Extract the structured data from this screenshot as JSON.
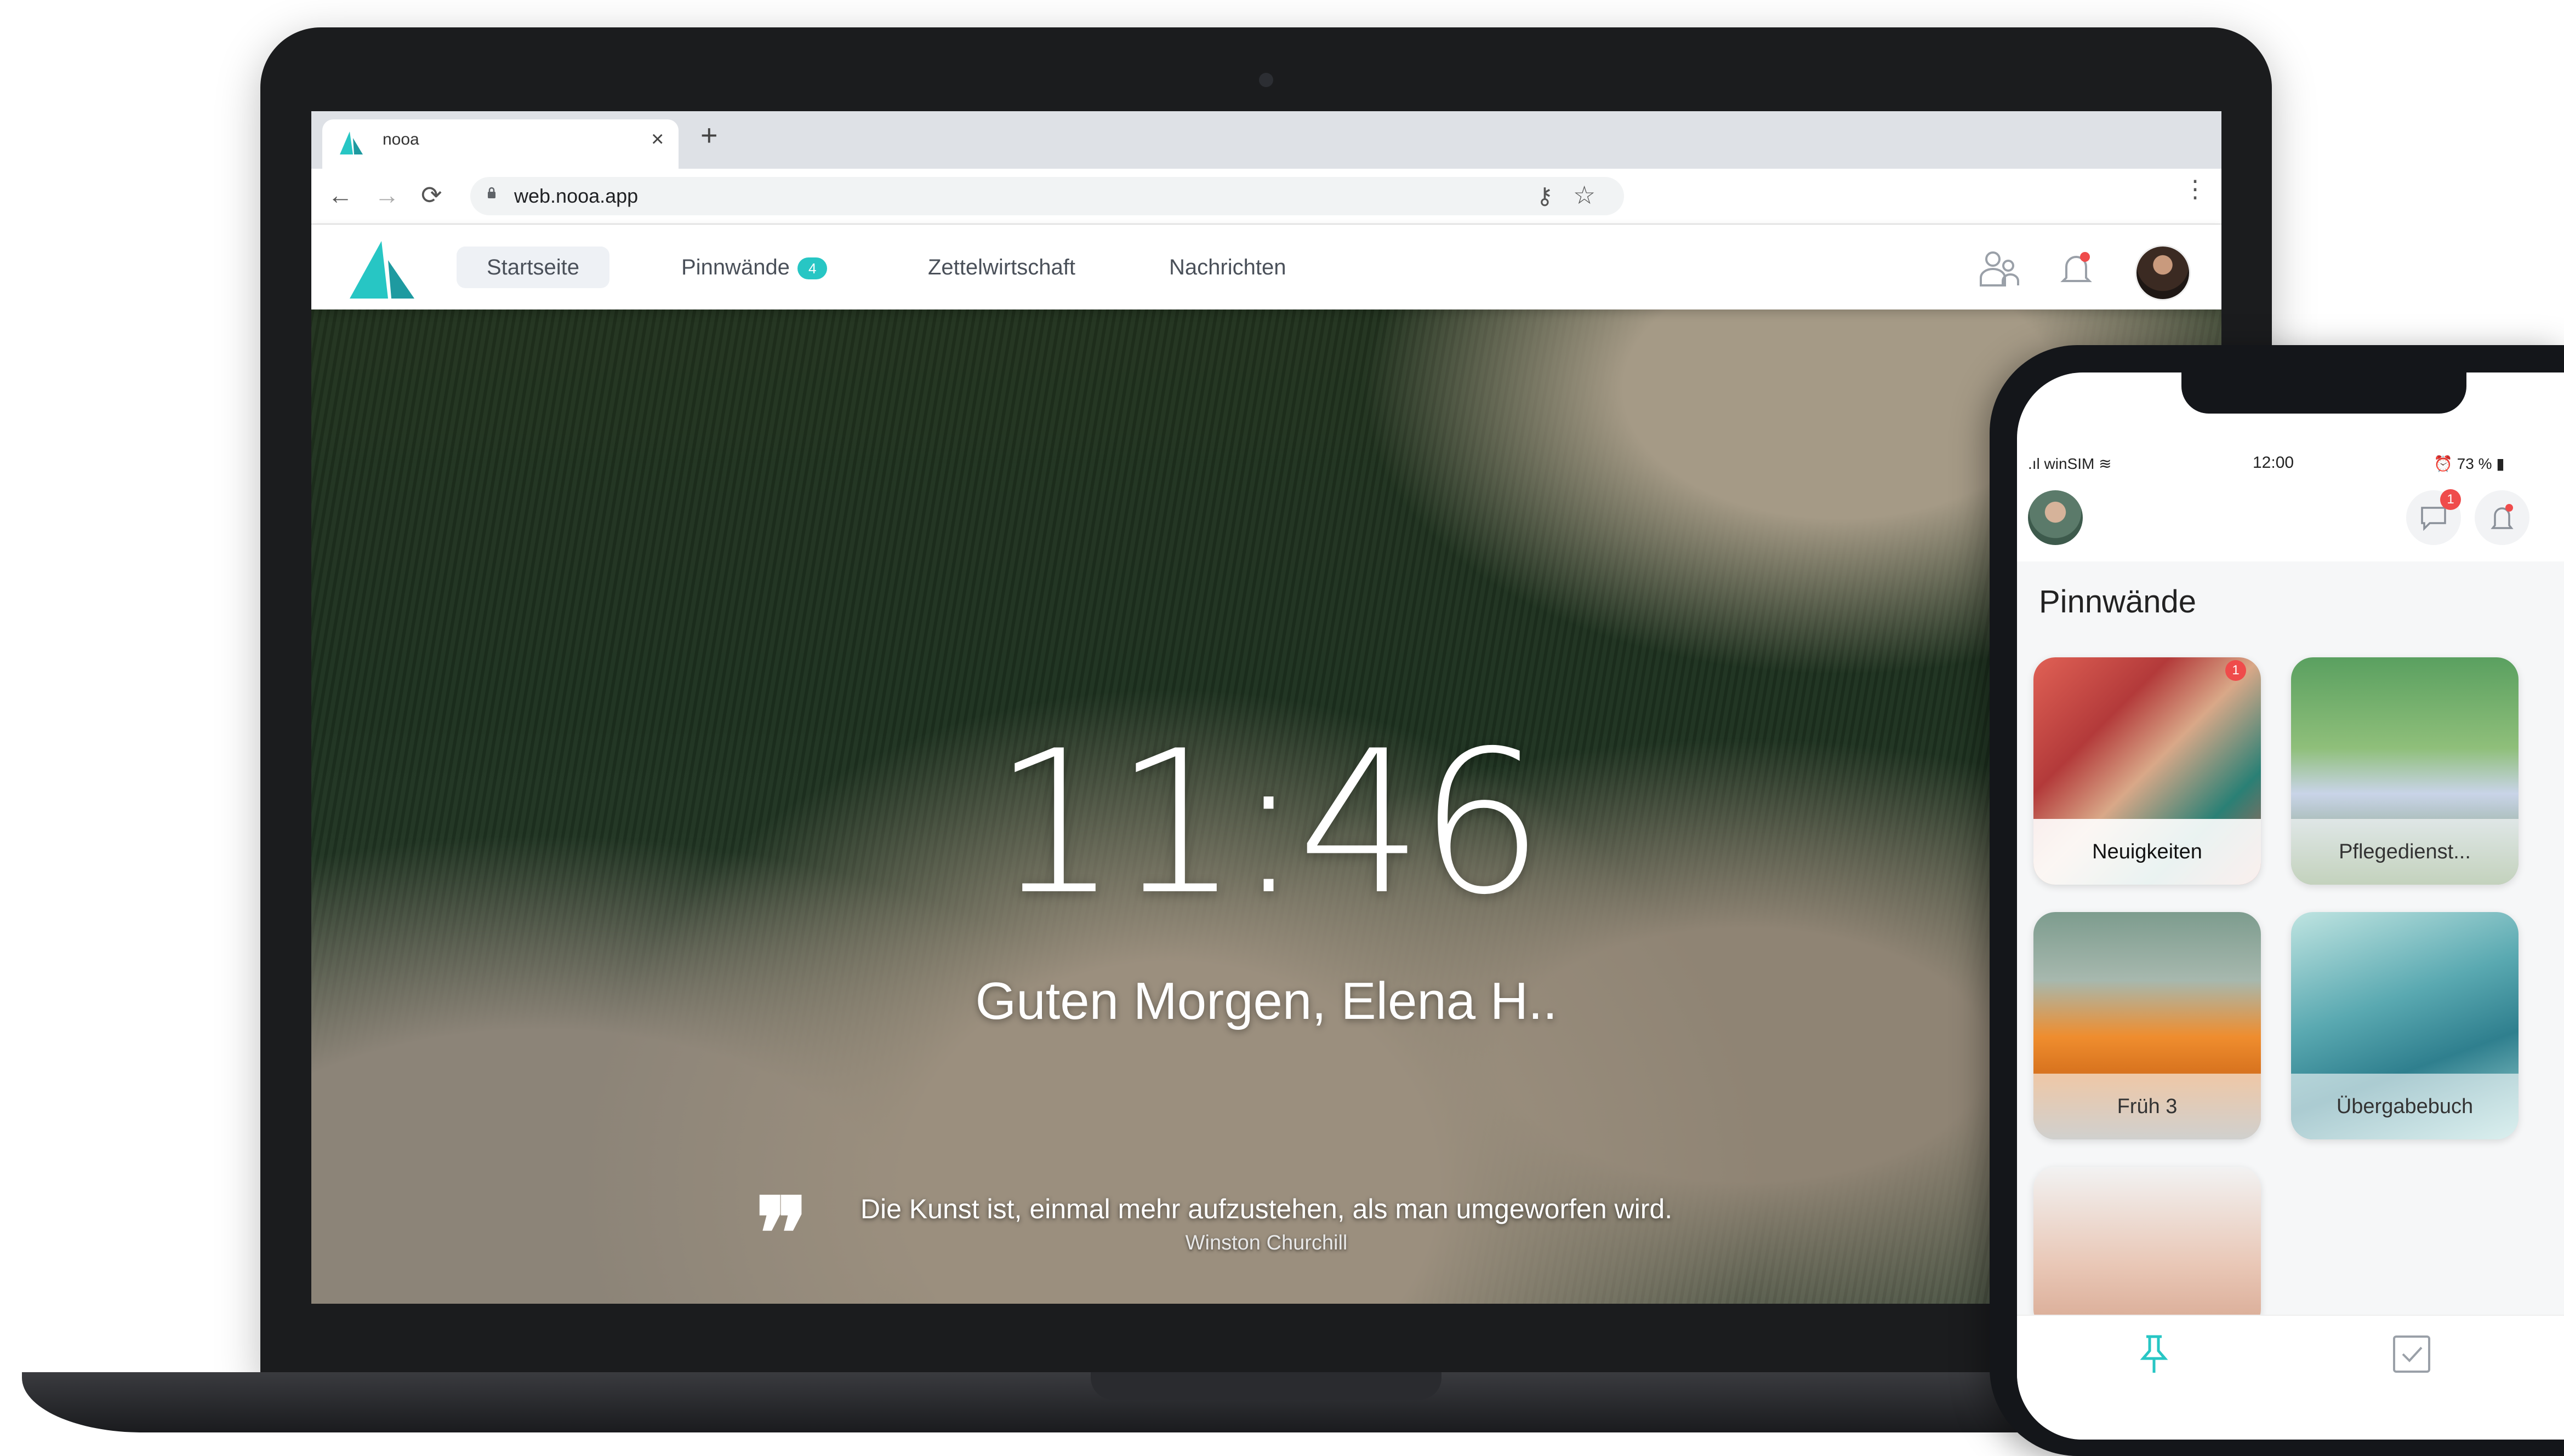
{
  "browser": {
    "tab_title": "nooa",
    "close_symbol": "×",
    "new_tab_symbol": "+",
    "url": "web.nooa.app",
    "back_symbol": "←",
    "forward_symbol": "→",
    "reload_symbol": "⟳",
    "key_symbol": "⚷",
    "star_symbol": "☆",
    "menu_symbol": "⋮"
  },
  "app": {
    "brand_color": "#27c6c4",
    "nav": {
      "home": "Startseite",
      "boards": "Pinnwände",
      "boards_badge": "4",
      "notes": "Zettelwirtschaft",
      "messages": "Nachrichten"
    },
    "icons": [
      "users-icon",
      "bell-icon",
      "avatar"
    ]
  },
  "home": {
    "clock": "11:46",
    "greeting": "Guten Morgen, Elena H..",
    "quote_mark": "❞",
    "quote": "Die Kunst ist, einmal mehr aufzustehen, als man umgeworfen wird.",
    "quote_author": "Winston Churchill"
  },
  "phone": {
    "status": {
      "carrier": ".ıl winSIM ≋",
      "time": "12:00",
      "battery": "⏰ 73 % ▮"
    },
    "chat_badge": "1",
    "heading": "Pinnwände",
    "cards": [
      {
        "label": "Neuigkeiten",
        "badge": "1"
      },
      {
        "label": "Pflegedienst..."
      },
      {
        "label": "Früh 3"
      },
      {
        "label": "Übergabebuch"
      }
    ]
  }
}
